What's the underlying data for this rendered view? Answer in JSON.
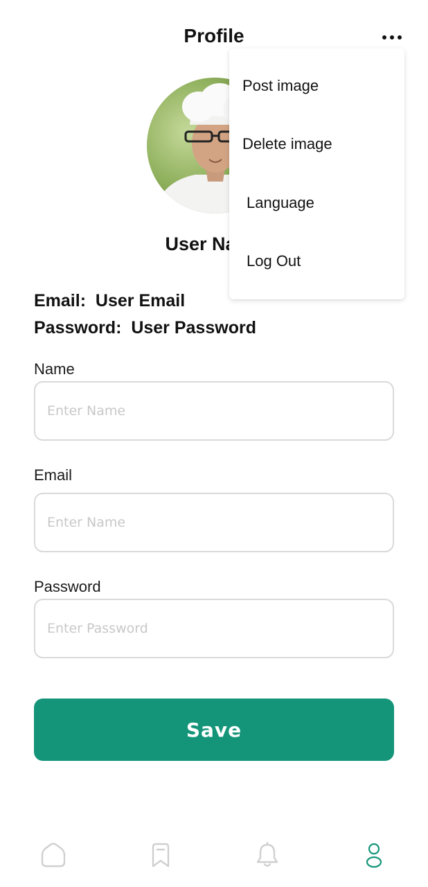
{
  "header": {
    "title": "Profile",
    "more_icon": "more-horizontal-icon"
  },
  "profile": {
    "user_name": "User Name",
    "email_line": "Email:  User Email",
    "password_line": "Password:  User Password"
  },
  "form": {
    "name_label": "Name",
    "name_placeholder": "Enter Name",
    "email_label": "Email",
    "email_placeholder": "Enter Name",
    "password_label": "Password",
    "password_placeholder": "Enter Password",
    "save_label": "Save"
  },
  "menu": {
    "items": [
      {
        "label": "Post image"
      },
      {
        "label": "Delete image"
      },
      {
        "label": "Language"
      },
      {
        "label": "Log Out"
      }
    ]
  },
  "bottom_nav": {
    "items": [
      {
        "icon": "home-icon",
        "active": false
      },
      {
        "icon": "bookmark-icon",
        "active": false
      },
      {
        "icon": "bell-icon",
        "active": false
      },
      {
        "icon": "profile-icon",
        "active": true
      }
    ]
  },
  "colors": {
    "accent": "#14957A",
    "nav_inactive": "#cfcfcf",
    "nav_active": "#14957A"
  }
}
